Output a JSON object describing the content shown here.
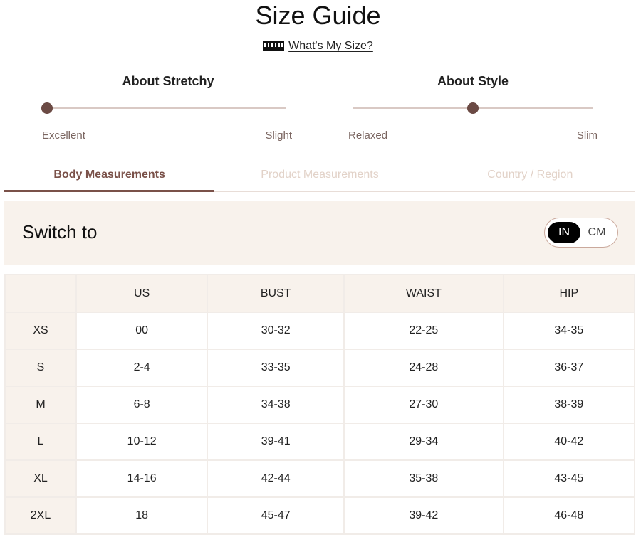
{
  "page": {
    "title": "Size Guide",
    "whats_my_size": "What's My Size?"
  },
  "stretchy": {
    "title": "About Stretchy",
    "left_label": "Excellent",
    "right_label": "Slight",
    "level": 0.0
  },
  "style": {
    "title": "About Style",
    "left_label": "Relaxed",
    "right_label": "Slim",
    "level": 0.5
  },
  "tabs": [
    {
      "label": "Body Measurements",
      "active": true
    },
    {
      "label": "Product Measurements",
      "active": false
    },
    {
      "label": "Country / Region",
      "active": false
    }
  ],
  "units": {
    "label": "Switch to",
    "in": "IN",
    "cm": "CM",
    "selected": "IN"
  },
  "table": {
    "headers": [
      "",
      "US",
      "BUST",
      "WAIST",
      "HIP"
    ],
    "rows": [
      [
        "XS",
        "00",
        "30-32",
        "22-25",
        "34-35"
      ],
      [
        "S",
        "2-4",
        "33-35",
        "24-28",
        "36-37"
      ],
      [
        "M",
        "6-8",
        "34-38",
        "27-30",
        "38-39"
      ],
      [
        "L",
        "10-12",
        "39-41",
        "29-34",
        "40-42"
      ],
      [
        "XL",
        "14-16",
        "42-44",
        "35-38",
        "43-45"
      ],
      [
        "2XL",
        "18",
        "45-47",
        "39-42",
        "46-48"
      ]
    ]
  },
  "colors": {
    "accent": "#7a5149",
    "knob": "#6b4a44",
    "panel": "#f8f2ec",
    "inactive_tab": "#e2d2c8"
  }
}
